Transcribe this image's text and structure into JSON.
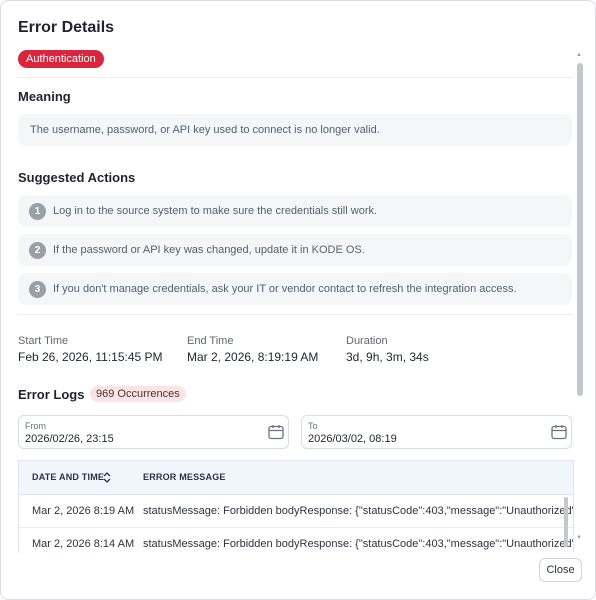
{
  "modal": {
    "title": "Error Details",
    "badge": "Authentication",
    "close_label": "Close"
  },
  "meaning": {
    "heading": "Meaning",
    "text": "The username, password, or API key used to connect is no longer valid."
  },
  "actions": {
    "heading": "Suggested Actions",
    "items": [
      {
        "num": "1",
        "text": "Log in to the source system to make sure the credentials still work."
      },
      {
        "num": "2",
        "text": "If the password or API key was changed, update it in KODE OS."
      },
      {
        "num": "3",
        "text": "If you don't manage credentials, ask your IT or vendor contact to refresh the integration access."
      }
    ]
  },
  "timing": {
    "start_label": "Start Time",
    "start_value": "Feb 26, 2026, 11:15:45 PM",
    "end_label": "End Time",
    "end_value": "Mar 2, 2026, 8:19:19 AM",
    "duration_label": "Duration",
    "duration_value": "3d, 9h, 3m, 34s"
  },
  "logs": {
    "heading": "Error Logs",
    "occurrences": "969 Occurrences",
    "from_label": "From",
    "from_value": "2026/02/26, 23:15",
    "to_label": "To",
    "to_value": "2026/03/02, 08:19",
    "columns": [
      "DATE AND TIME",
      "ERROR MESSAGE"
    ],
    "rows": [
      {
        "date": "Mar 2, 2026 8:19 AM",
        "message": "statusMessage: Forbidden bodyResponse: {\"statusCode\":403,\"message\":\"Unauthorized\"}"
      },
      {
        "date": "Mar 2, 2026 8:14 AM",
        "message": "statusMessage: Forbidden bodyResponse: {\"statusCode\":403,\"message\":\"Unauthorized\"}"
      }
    ]
  },
  "colors": {
    "badge": "#d7263d",
    "occurrence_bg": "#fde4e4",
    "table_header": "#f1f5fc"
  }
}
